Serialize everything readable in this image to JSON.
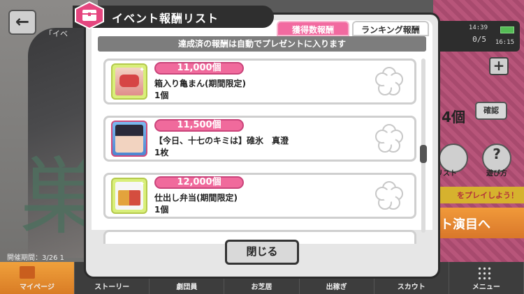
{
  "background": {
    "sub_title": "「イベ",
    "kanji": "巣",
    "status": {
      "time": "14:39",
      "clock": "16:15",
      "counter": "0/5"
    },
    "count_display": "4個",
    "confirm_label": "確認",
    "list_label": "リスト",
    "howto_label": "遊び方",
    "play_prompt": "をプレイしよう！",
    "event_button": "ト演目へ",
    "period_text": "開催期間：3/26 1"
  },
  "bottom_nav": [
    "マイページ",
    "ストーリー",
    "劇団員",
    "お芝居",
    "出稼ぎ",
    "スカウト",
    "メニュー"
  ],
  "modal": {
    "title": "イベント報酬リスト",
    "tabs": [
      "獲得数報酬",
      "ランキング報酬"
    ],
    "notice": "達成済の報酬は自動でプレゼントに入ります",
    "items": [
      {
        "threshold": "11,000個",
        "name": "箱入り亀まん(期間限定)",
        "qty": "1個"
      },
      {
        "threshold": "11,500個",
        "name": "【今日、十七のキミは】碓氷　真澄",
        "qty": "1枚"
      },
      {
        "threshold": "12,000個",
        "name": "仕出し弁当(期間限定)",
        "qty": "1個"
      }
    ],
    "close_label": "閉じる"
  },
  "colors": {
    "accent_pink": "#f06a9c",
    "title_bar": "#2f2f2f",
    "notice_gray": "#7d7d7d"
  }
}
